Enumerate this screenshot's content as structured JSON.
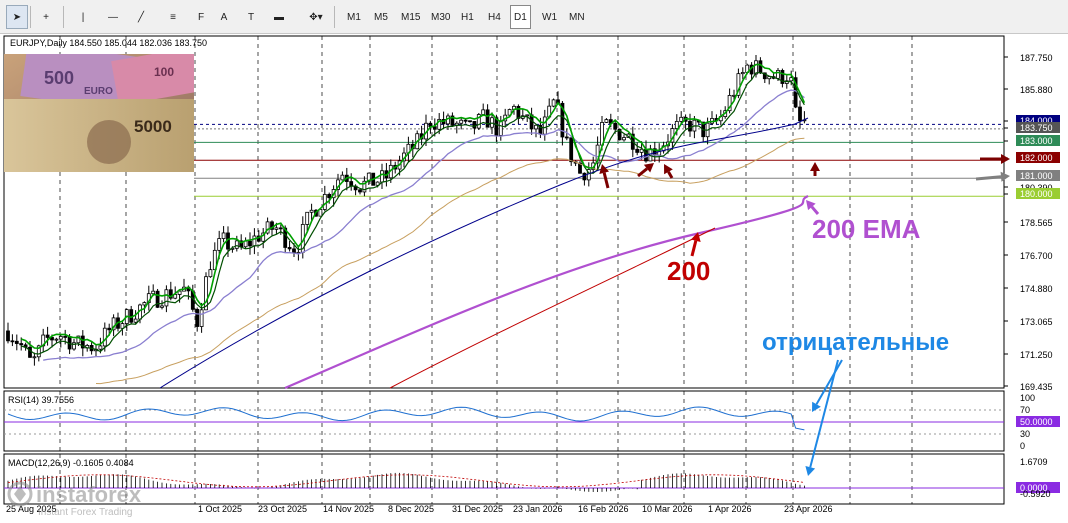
{
  "toolbar": {
    "tools": [
      {
        "icon": "cursor-arrow-icon",
        "glyph": "➤"
      },
      {
        "icon": "crosshair-icon",
        "glyph": "+"
      },
      {
        "icon": "vertical-line-icon",
        "glyph": "|"
      },
      {
        "icon": "horizontal-line-icon",
        "glyph": "—"
      },
      {
        "icon": "trendline-icon",
        "glyph": "╱"
      },
      {
        "icon": "equidistant-channel-icon",
        "glyph": "≡"
      },
      {
        "icon": "fibonacci-icon",
        "glyph": "F"
      },
      {
        "icon": "text-icon",
        "glyph": "A"
      },
      {
        "icon": "text-label-icon",
        "glyph": "T"
      },
      {
        "icon": "rectangle-icon",
        "glyph": "▬"
      },
      {
        "icon": "shapes-menu-icon",
        "glyph": "✥▾"
      }
    ],
    "timeframes": [
      "M1",
      "M5",
      "M15",
      "M30",
      "H1",
      "H4",
      "D1",
      "W1",
      "MN"
    ],
    "active_timeframe": "D1"
  },
  "symbol_header": "EURJPY,Daily  184.550 185.044 182.036 183.750",
  "price_axis": [
    "187.750",
    "185.880",
    "184.000",
    "183.750",
    "183.000",
    "182.000",
    "181.000",
    "180.390",
    "180.000",
    "178.565",
    "176.700",
    "174.880",
    "173.065",
    "171.250",
    "169.435"
  ],
  "price_tags": [
    {
      "label": "184.000",
      "color": "#000080"
    },
    {
      "label": "183.750",
      "color": "#555555"
    },
    {
      "label": "183.000",
      "color": "#2e8b57"
    },
    {
      "label": "182.000",
      "color": "#8b0000"
    },
    {
      "label": "181.000",
      "color": "#808080"
    },
    {
      "label": "180.000",
      "color": "#9acd32"
    }
  ],
  "date_axis": [
    "25 Aug 2025",
    "",
    "1 Oct 2025",
    "23 Oct 2025",
    "14 Nov 2025",
    "8 Dec 2025",
    "31 Dec 2025",
    "23 Jan 2026",
    "16 Feb 2026",
    "10 Mar 2026",
    "1 Apr 2026",
    "23 Apr 2026"
  ],
  "annotations": {
    "ema_label": "200 EMA",
    "sma_label": "200",
    "negative_label": "отрицательные"
  },
  "rsi": {
    "header": "RSI(14) 39.7556",
    "levels": [
      "100",
      "70",
      "50.0000",
      "30",
      "0"
    ]
  },
  "macd": {
    "header": "MACD(12,26,9) -0.1605 0.4084",
    "levels": [
      "1.6709",
      "0.0000",
      "-0.5920"
    ]
  },
  "thumbnail_bills": [
    "500",
    "EURO",
    "100",
    "5000"
  ],
  "logo": {
    "brand": "instaforex",
    "tagline": "Instant Forex Trading"
  },
  "colors": {
    "ema_200": "#b050d0",
    "sma_200": "#c00000",
    "ma_blue": "#00008b",
    "ma_green": "#00a000",
    "rsi_line": "#1e6fd0",
    "neg_text": "#1e88e5",
    "arrow_dark": "#7b0000",
    "arrow_gray": "#808080"
  }
}
